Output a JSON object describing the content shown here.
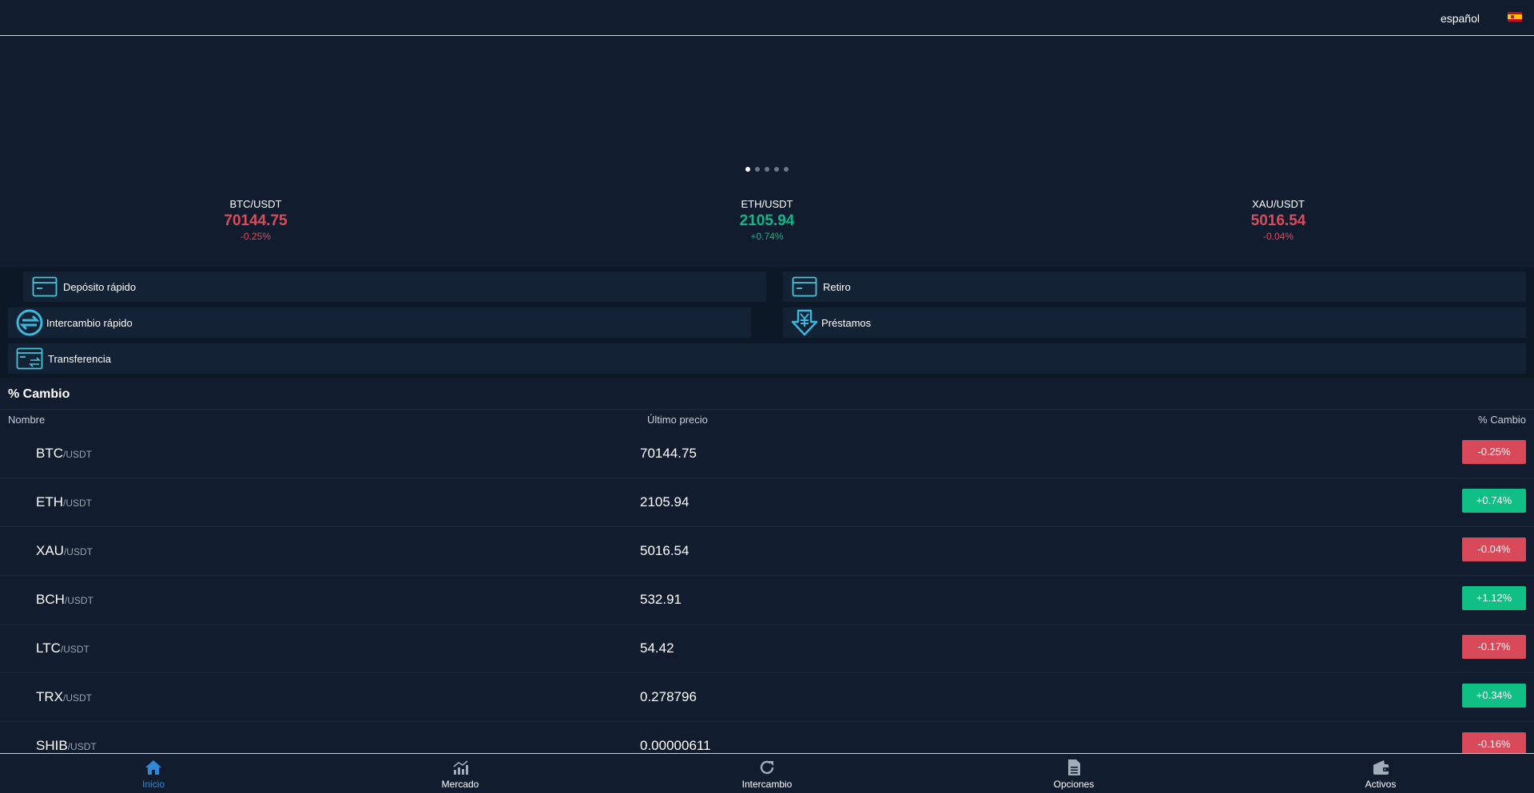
{
  "header": {
    "language": "español"
  },
  "banner": {
    "dots": 5,
    "active_dot": 1
  },
  "tickers": [
    {
      "pair": "BTC/USDT",
      "price": "70144.75",
      "change": "-0.25%",
      "direction": "down"
    },
    {
      "pair": "ETH/USDT",
      "price": "2105.94",
      "change": "+0.74%",
      "direction": "up"
    },
    {
      "pair": "XAU/USDT",
      "price": "5016.54",
      "change": "-0.04%",
      "direction": "down"
    }
  ],
  "actions": {
    "deposit": "Depósito rápido",
    "withdraw": "Retiro",
    "swap": "Intercambio rápido",
    "loans": "Préstamos",
    "transfer": "Transferencia"
  },
  "market": {
    "title": "% Cambio",
    "columns": {
      "name": "Nombre",
      "price": "Último precio",
      "change": "% Cambio"
    },
    "rows": [
      {
        "base": "BTC",
        "quote": "/USDT",
        "price": "70144.75",
        "change": "-0.25%",
        "direction": "down"
      },
      {
        "base": "ETH",
        "quote": "/USDT",
        "price": "2105.94",
        "change": "+0.74%",
        "direction": "up"
      },
      {
        "base": "XAU",
        "quote": "/USDT",
        "price": "5016.54",
        "change": "-0.04%",
        "direction": "down"
      },
      {
        "base": "BCH",
        "quote": "/USDT",
        "price": "532.91",
        "change": "+1.12%",
        "direction": "up"
      },
      {
        "base": "LTC",
        "quote": "/USDT",
        "price": "54.42",
        "change": "-0.17%",
        "direction": "down"
      },
      {
        "base": "TRX",
        "quote": "/USDT",
        "price": "0.278796",
        "change": "+0.34%",
        "direction": "up"
      },
      {
        "base": "SHIB",
        "quote": "/USDT",
        "price": "0.00000611",
        "change": "-0.16%",
        "direction": "down"
      }
    ]
  },
  "nav": {
    "home": "Inicio",
    "market": "Mercado",
    "exchange": "Intercambio",
    "options": "Opciones",
    "assets": "Activos"
  },
  "colors": {
    "background": "#111d2e",
    "up": "#0fbf84",
    "down": "#d8495a",
    "active_nav": "#2f88d8",
    "action_icon": "#49c5d9"
  }
}
